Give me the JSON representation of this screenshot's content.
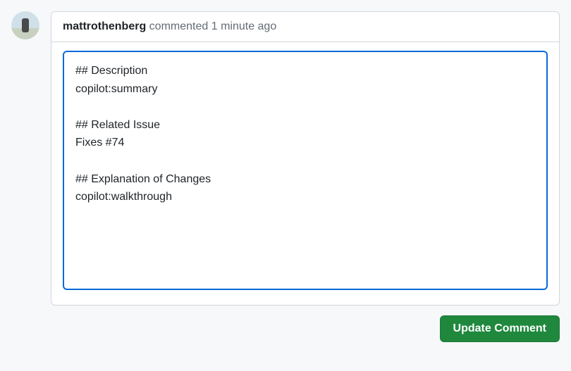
{
  "comment": {
    "username": "mattrothenberg",
    "action_text": " commented ",
    "timestamp": "1 minute ago",
    "body": "## Description\ncopilot:summary\n\n## Related Issue\nFixes #74\n\n## Explanation of Changes\ncopilot:walkthrough"
  },
  "actions": {
    "update_label": "Update Comment"
  }
}
